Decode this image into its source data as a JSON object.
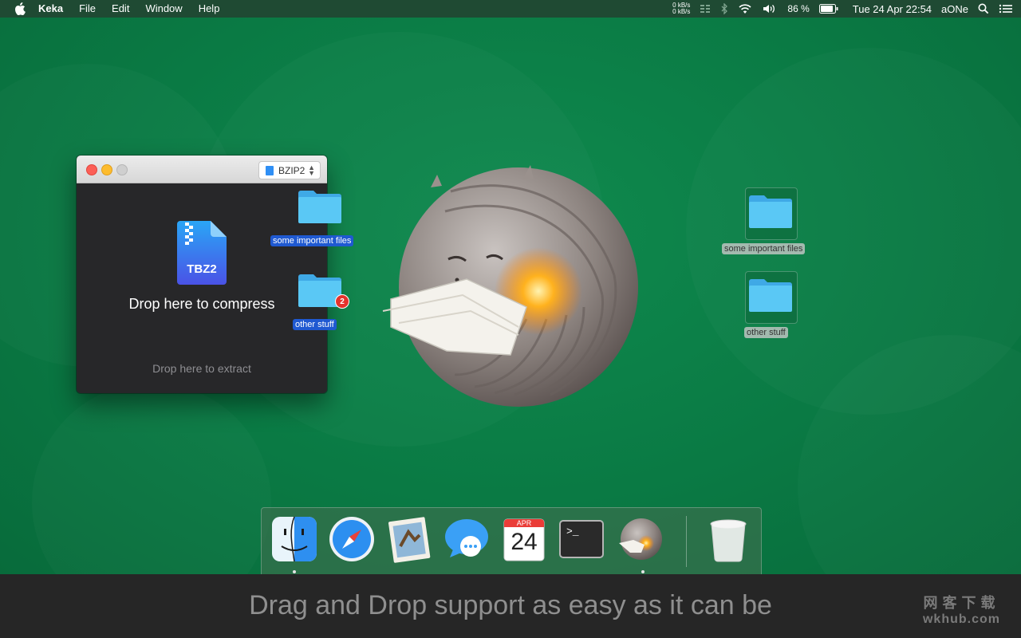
{
  "menubar": {
    "app_name": "Keka",
    "menus": [
      "File",
      "Edit",
      "Window",
      "Help"
    ],
    "net_up": "0 kB/s",
    "net_down": "0 kB/s",
    "battery": "86 %",
    "datetime": "Tue 24 Apr  22:54",
    "user": "aONe"
  },
  "window": {
    "format": "BZIP2",
    "file_badge": "TBZ2",
    "compress_label": "Drop here to compress",
    "extract_label": "Drop here to extract"
  },
  "dragged": [
    {
      "label": "some important files"
    },
    {
      "label": "other stuff",
      "badge": "2"
    }
  ],
  "desktop_items": [
    {
      "label": "some important files"
    },
    {
      "label": "other stuff"
    }
  ],
  "dock": {
    "items": [
      "finder-icon",
      "safari-icon",
      "mail-icon",
      "messages-icon",
      "calendar-icon",
      "terminal-icon",
      "keka-icon",
      "trash-icon"
    ],
    "calendar_month": "APR",
    "calendar_day": "24",
    "terminal_prompt": ">_"
  },
  "caption": "Drag and Drop support as easy as it can be",
  "watermark": {
    "line1": "网客下载",
    "line2": "wkhub.com"
  },
  "colors": {
    "desktop": "#0b7a45",
    "selection": "#1f59d1",
    "folder": "#5ac8f5"
  }
}
